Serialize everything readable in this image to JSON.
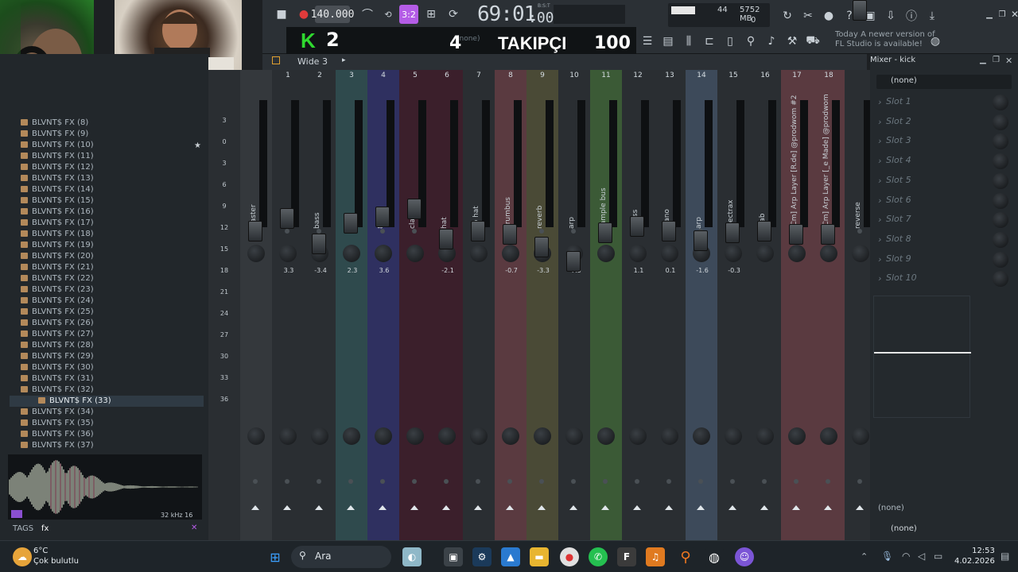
{
  "toolbar": {
    "tempo": "140.000",
    "pattern": "3:2",
    "time_main": "69:01",
    "time_sub": ":00",
    "time_small": "B:S:T",
    "cpu_value": "44",
    "mem_value": "5752 MB",
    "mem_sub": "0",
    "notice_line1": "Today  A newer version of",
    "notice_line2": "FL Studio is available!",
    "preset_none": "(none)"
  },
  "stream": {
    "k_label": "K",
    "k_count": "2",
    "followers_left": "4",
    "followers_label": "TAKIPÇI",
    "followers_right": "100"
  },
  "browser": {
    "header_label": "Wide 3",
    "items": [
      "BLVNT$ FX (8)",
      "BLVNT$ FX (9)",
      "BLVNT$ FX (10)",
      "BLVNT$ FX (11)",
      "BLVNT$ FX (12)",
      "BLVNT$ FX (13)",
      "BLVNT$ FX (14)",
      "BLVNT$ FX (15)",
      "BLVNT$ FX (16)",
      "BLVNT$ FX (17)",
      "BLVNT$ FX (18)",
      "BLVNT$ FX (19)",
      "BLVNT$ FX (20)",
      "BLVNT$ FX (21)",
      "BLVNT$ FX (22)",
      "BLVNT$ FX (23)",
      "BLVNT$ FX (24)",
      "BLVNT$ FX (25)",
      "BLVNT$ FX (26)",
      "BLVNT$ FX (27)",
      "BLVNT$ FX (28)",
      "BLVNT$ FX (29)",
      "BLVNT$ FX (30)",
      "BLVNT$ FX (31)",
      "BLVNT$ FX (32)",
      "BLVNT$ FX (33)",
      "BLVNT$ FX (34)",
      "BLVNT$ FX (35)",
      "BLVNT$ FX (36)",
      "BLVNT$ FX (37)"
    ],
    "selected_index": 25,
    "wave_info": "32 kHz 16",
    "tags_label": "TAGS",
    "tags_value": "fx"
  },
  "mixer": {
    "scale": [
      "3",
      "0",
      "3",
      "6",
      "9",
      "12",
      "15",
      "18",
      "21",
      "24",
      "27",
      "30",
      "33",
      "36"
    ],
    "strips": [
      {
        "num": "",
        "name": "Master",
        "vol": "",
        "color": "#34383c"
      },
      {
        "num": "1",
        "name": "808",
        "vol": "3.3",
        "color": "#2a2e32"
      },
      {
        "num": "2",
        "name": "bass",
        "vol": "-3.4",
        "color": "#2a2e32"
      },
      {
        "num": "3",
        "name": "kick",
        "vol": "2.3",
        "color": "#2f4a4d"
      },
      {
        "num": "4",
        "name": "808",
        "vol": "3.6",
        "color": "#2f3060"
      },
      {
        "num": "5",
        "name": "clap",
        "vol": "",
        "color": "#3b1f2b"
      },
      {
        "num": "6",
        "name": "hat",
        "vol": "-2.1",
        "color": "#3b1f2b"
      },
      {
        "num": "7",
        "name": "op hat",
        "vol": "",
        "color": "#2a2e32"
      },
      {
        "num": "8",
        "name": "drumbus",
        "vol": "-0.7",
        "color": "#5a3a40"
      },
      {
        "num": "9",
        "name": "reverb",
        "vol": "-3.3",
        "color": "#4a4a36"
      },
      {
        "num": "10",
        "name": "arp",
        "vol": "-7.5",
        "color": "#2a2e32"
      },
      {
        "num": "11",
        "name": "sample bus",
        "vol": "",
        "color": "#3b5a36"
      },
      {
        "num": "12",
        "name": "brass",
        "vol": "1.1",
        "color": "#2a2e32"
      },
      {
        "num": "13",
        "name": "piano",
        "vol": "0.1",
        "color": "#2a2e32"
      },
      {
        "num": "14",
        "name": "arp",
        "vol": "-1.6",
        "color": "#3d4a5a"
      },
      {
        "num": "15",
        "name": "electrax",
        "vol": "-0.3",
        "color": "#2a2e32"
      },
      {
        "num": "16",
        "name": "stab",
        "vol": "",
        "color": "#2a2e32"
      },
      {
        "num": "17",
        "name": "[Cm] Arp Layer [R.de] @prodwom #2",
        "vol": "",
        "color": "#5a3a40"
      },
      {
        "num": "18",
        "name": "[Cm] Arp Layer [_e Made] @prodwom",
        "vol": "",
        "color": "#5a3a40"
      },
      {
        "num": "",
        "name": "reverse",
        "vol": "",
        "color": "#2a2e32"
      }
    ]
  },
  "rightpanel": {
    "title": "Mixer - kick",
    "input": "(none)",
    "slots": [
      "Slot 1",
      "Slot 2",
      "Slot 3",
      "Slot 4",
      "Slot 5",
      "Slot 6",
      "Slot 7",
      "Slot 8",
      "Slot 9",
      "Slot 10"
    ],
    "out1": "(none)",
    "out2": "(none)"
  },
  "taskbar": {
    "search_placeholder": "Ara",
    "weather_temp": "6°C",
    "weather_desc": "Çok bulutlu",
    "time": "12:53",
    "date": "4.02.2026"
  }
}
